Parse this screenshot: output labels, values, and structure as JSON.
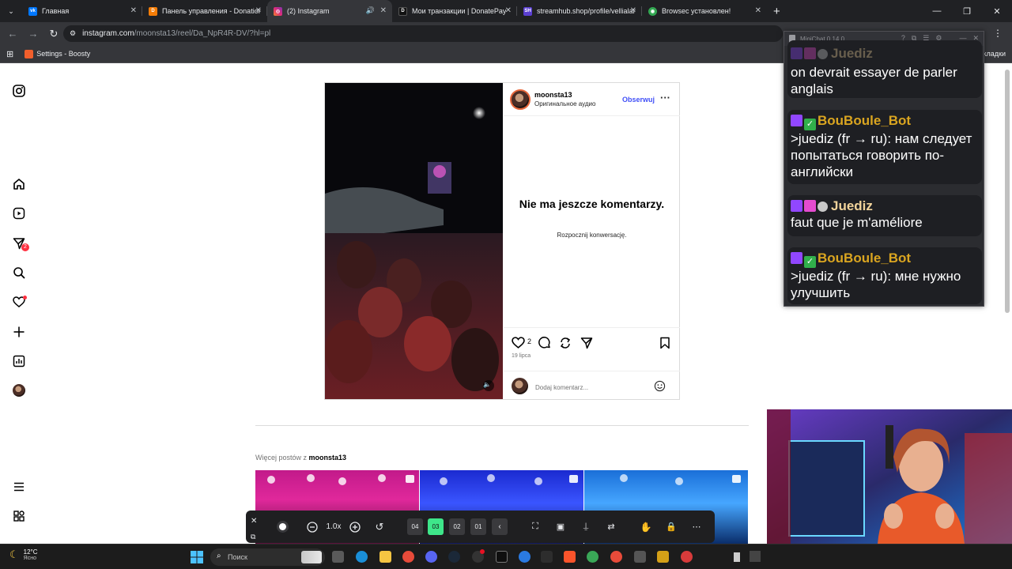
{
  "browser": {
    "tabs": [
      {
        "label": "Главная",
        "icon": "vk-icon",
        "color": "#0077ff",
        "active": false
      },
      {
        "label": "Панель управления - Donation",
        "icon": "donationalerts-icon",
        "color": "#f57d07",
        "active": false
      },
      {
        "label": "(2) Instagram",
        "icon": "instagram-icon",
        "color": "#e1306c",
        "active": true
      },
      {
        "label": "Мои транзакции | DonatePay",
        "icon": "donatepay-icon",
        "color": "#1c1c1c",
        "active": false
      },
      {
        "label": "streamhub.shop/profile/vellialan",
        "icon": "streamhub-icon",
        "color": "#5b3fd1",
        "active": false
      },
      {
        "label": "Browsec установлен!",
        "icon": "browsec-icon",
        "color": "#33a852",
        "active": false
      }
    ],
    "address": {
      "host": "instagram.com",
      "path": "/moonsta13/reel/Da_NpR4R-DV/?hl=pl"
    },
    "bookmarks": [
      {
        "label": "Settings - Boosty"
      }
    ],
    "bookmarks_right": "кладки"
  },
  "instagram": {
    "sidebar_badge": "2",
    "post": {
      "username": "moonsta13",
      "audio": "Оригинальное аудио",
      "follow": "Obserwuj",
      "more": "···",
      "no_comments": "Nie ma jeszcze komentarzy.",
      "start_conversation": "Rozpocznij konwersację.",
      "likes": "2",
      "date": "19 lipca",
      "add_comment_placeholder": "Dodaj komentarz..."
    },
    "more_posts_prefix": "Więcej postów z",
    "more_posts_user": "moonsta13"
  },
  "zoom_toolbar": {
    "zoom_level": "1.0x",
    "presets": [
      {
        "label": "04",
        "active": false
      },
      {
        "label": "03",
        "active": true
      },
      {
        "label": "02",
        "active": false
      },
      {
        "label": "01",
        "active": false
      }
    ],
    "accent": "#3ee68a"
  },
  "minichat": {
    "title": "MiniChat 0.14.0",
    "messages": [
      {
        "user": "Juediz",
        "user_color": "#f2d49b",
        "text": "on devrait essayer de parler anglais",
        "badges": [
          "twitch",
          "gem",
          "ghost"
        ]
      },
      {
        "user": "BouBoule_Bot",
        "user_color": "#daa520",
        "text": ">juediz (fr → ru): нам следует попытаться говорить по-английски",
        "badges": [
          "twitch",
          "check"
        ]
      },
      {
        "user": "Juediz",
        "user_color": "#f2d49b",
        "text": "faut que je m'améliore",
        "badges": [
          "twitch",
          "gem",
          "ghost"
        ]
      },
      {
        "user": "BouBoule_Bot",
        "user_color": "#daa520",
        "text": ">juediz (fr → ru): мне нужно улучшить",
        "badges": [
          "twitch",
          "check"
        ]
      }
    ]
  },
  "taskbar": {
    "temperature": "12°C",
    "weather": "Ясно",
    "search_placeholder": "Поиск"
  }
}
